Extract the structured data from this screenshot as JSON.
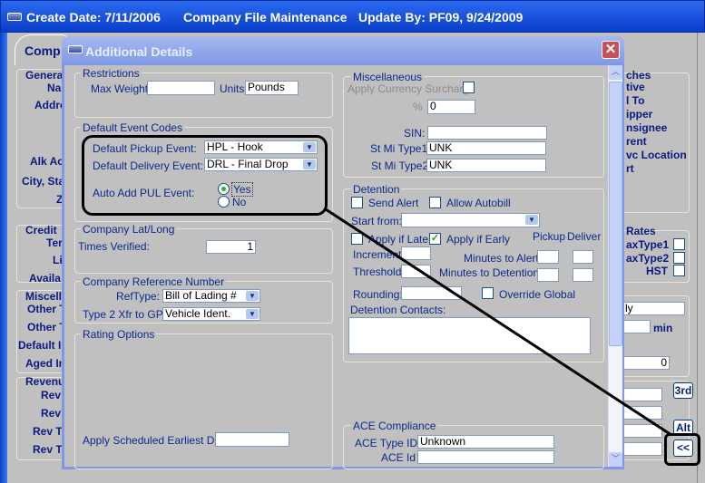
{
  "window": {
    "create_date": "Create Date: 7/11/2006",
    "title": "Company File Maintenance",
    "update_by": "Update By: PF09, 9/24/2009"
  },
  "background": {
    "tab": "Comp",
    "left_labels": [
      "Genera",
      "Na",
      "Addre",
      "Alk Ac",
      "City, Sta",
      "Z",
      "Credit",
      "Ter",
      "Li",
      "Availa",
      "Miscell",
      "Other T",
      "Other T",
      "Default I",
      "Aged In",
      "Revenu",
      "Rev",
      "Rev",
      "Rev T",
      "Rev T"
    ],
    "right_labels": [
      "ches",
      "tive",
      "l To",
      "ipper",
      "nsignee",
      "rent",
      "vc Location",
      "rt"
    ],
    "rates": {
      "title": "Rates",
      "items": [
        "axType1",
        "axType2",
        "HST"
      ]
    },
    "field_ly": "ly",
    "min_label": "min",
    "field_zero": "0",
    "buttons": {
      "third": "3rd",
      "alt": "Alt",
      "collapse": "<<"
    }
  },
  "dialog": {
    "title": "Additional Details",
    "restrictions": {
      "title": "Restrictions",
      "max_weight_label": "Max Weight:",
      "max_weight": "",
      "units_label": "Units:",
      "units": "Pounds"
    },
    "event_codes": {
      "title": "Default Event Codes",
      "pickup_label": "Default Pickup Event:",
      "pickup": "HPL - Hook Preloaded",
      "delivery_label": "Default Delivery Event:",
      "delivery": "DRL - Final Drop Load",
      "auto_add_label": "Auto Add PUL Event:",
      "yes": "Yes",
      "no": "No",
      "selected": "Yes"
    },
    "latlong": {
      "title": "Company Lat/Long",
      "times_verified_label": "Times Verified:",
      "times_verified": "1"
    },
    "refnum": {
      "title": "Company Reference Number",
      "reftype_label": "RefType:",
      "reftype": "Bill of Lading #",
      "type2_label": "Type 2 Xfr to GP:",
      "type2": "Vehicle Ident."
    },
    "rating": {
      "title": "Rating Options",
      "sched_label": "Apply Scheduled Earliest Date:",
      "sched": ""
    },
    "misc": {
      "title": "Miscellaneous",
      "currency_label": "Apply Currency Surcharge",
      "pct_label": "%",
      "pct": "0",
      "sin_label": "SIN:",
      "sin": "",
      "stmi1_label": "St Mi Type1:",
      "stmi1": "UNK",
      "stmi2_label": "St Mi Type2:",
      "stmi2": "UNK"
    },
    "detention": {
      "title": "Detention",
      "send_alert": "Send Alert",
      "allow_autobill": "Allow Autobill",
      "start_from_label": "Start from:",
      "start_from": "",
      "apply_late": "Apply if Late",
      "apply_early": "Apply if Early",
      "apply_early_checked": true,
      "pickup": "Pickup",
      "deliver": "Deliver",
      "increment_label": "Increment:",
      "threshold_label": "Threshold:",
      "min_alert_label": "Minutes to Alert",
      "min_det_label": "Minutes to Detention",
      "rounding_label": "Rounding:",
      "override_global": "Override Global",
      "contacts_label": "Detention Contacts:"
    },
    "ace": {
      "title": "ACE Compliance",
      "type_label": "ACE Type ID",
      "type": "Unknown",
      "id_label": "ACE Id",
      "id": ""
    }
  },
  "colors": {
    "titlebar": "#0a3ec8",
    "dialog_title": "#7f97e6",
    "label": "#0c2a8a"
  }
}
